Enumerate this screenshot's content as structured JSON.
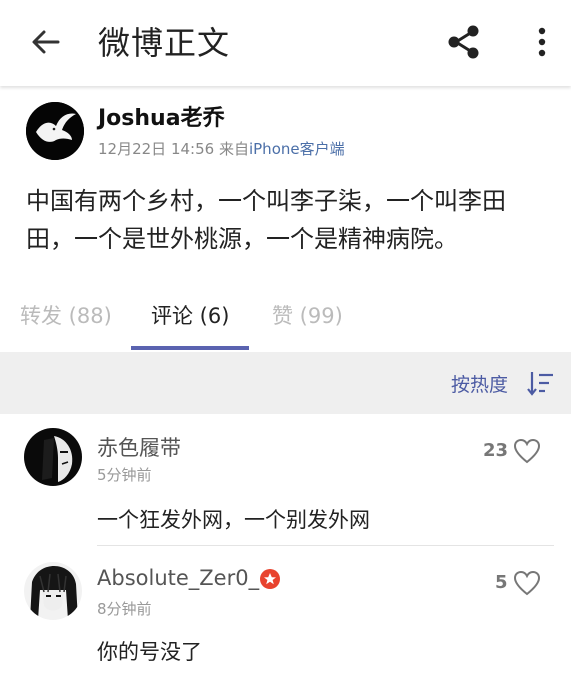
{
  "header": {
    "title": "微博正文",
    "icons": [
      "back-arrow-icon",
      "share-icon",
      "more-vertical-icon"
    ]
  },
  "post": {
    "author": "Joshua老乔",
    "date": "12月22日 14:56",
    "from_prefix": "来自",
    "source": "iPhone客户端",
    "text_line1": "中国有两个乡村，一个叫李子柒，一个叫李田",
    "text_line2": "田，一个是世外桃源，一个是精神病院。"
  },
  "tabs": [
    {
      "label": "转发 (88)"
    },
    {
      "label": "评论 (6)"
    },
    {
      "label": "赞 (99)"
    }
  ],
  "sort": {
    "label": "按热度"
  },
  "comments": [
    {
      "name": "赤色履带",
      "time": "5分钟前",
      "text": "一个狂发外网，一个别发外网",
      "likes": "23"
    },
    {
      "name": "Absolute_Zer0_",
      "time": "8分钟前",
      "text": "你的号没了",
      "likes": "5"
    }
  ],
  "colors": {
    "accent": "#5a63b0",
    "link": "#4b6fa8",
    "sort": "#4c5ba3",
    "badge": "#e8432e"
  }
}
